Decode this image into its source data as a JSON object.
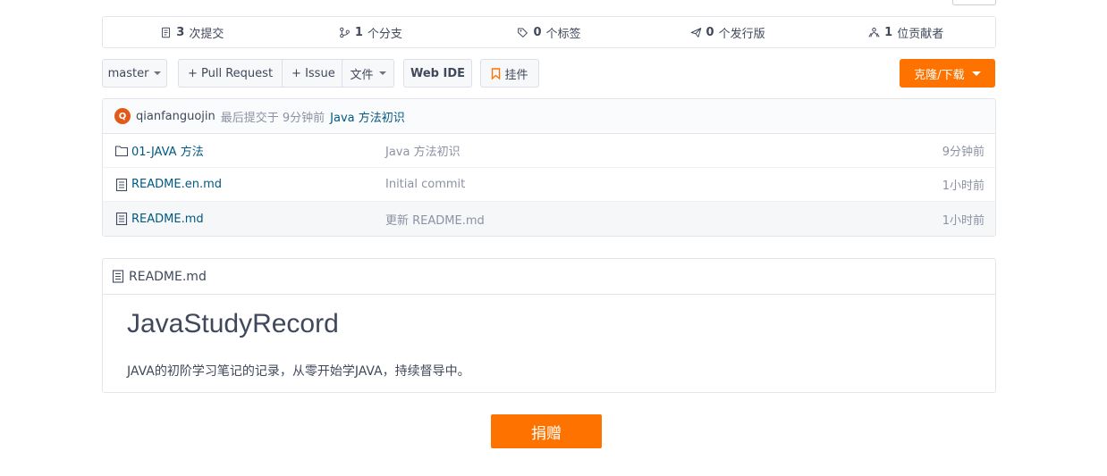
{
  "stats": {
    "commits": {
      "count": "3",
      "label": "次提交"
    },
    "branches": {
      "count": "1",
      "label": "个分支"
    },
    "tags": {
      "count": "0",
      "label": "个标签"
    },
    "releases": {
      "count": "0",
      "label": "个发行版"
    },
    "contributors": {
      "count": "1",
      "label": "位贡献者"
    }
  },
  "toolbar": {
    "branch": "master",
    "pull_request": "+ Pull Request",
    "issue": "+ Issue",
    "file_menu": "文件",
    "web_ide": "Web IDE",
    "widget": "挂件",
    "clone": "克隆/下载"
  },
  "commit": {
    "avatar_letter": "Q",
    "author": "qianfanguojin",
    "meta": "最后提交于 9分钟前",
    "message": "Java 方法初识"
  },
  "files": [
    {
      "type": "folder",
      "name": "01-JAVA 方法",
      "message": "Java 方法初识",
      "time": "9分钟前"
    },
    {
      "type": "file",
      "name": "README.en.md",
      "message": "Initial commit",
      "time": "1小时前"
    },
    {
      "type": "file",
      "name": "README.md",
      "message": "更新 README.md",
      "time": "1小时前"
    }
  ],
  "readme": {
    "filename": "README.md",
    "title": "JavaStudyRecord",
    "text": "JAVA的初阶学习笔记的记录，从零开始学JAVA，持续督导中。"
  },
  "donate": "捐赠",
  "colors": {
    "accent": "#fe7300",
    "link": "#005980",
    "muted": "#8c92a4"
  }
}
